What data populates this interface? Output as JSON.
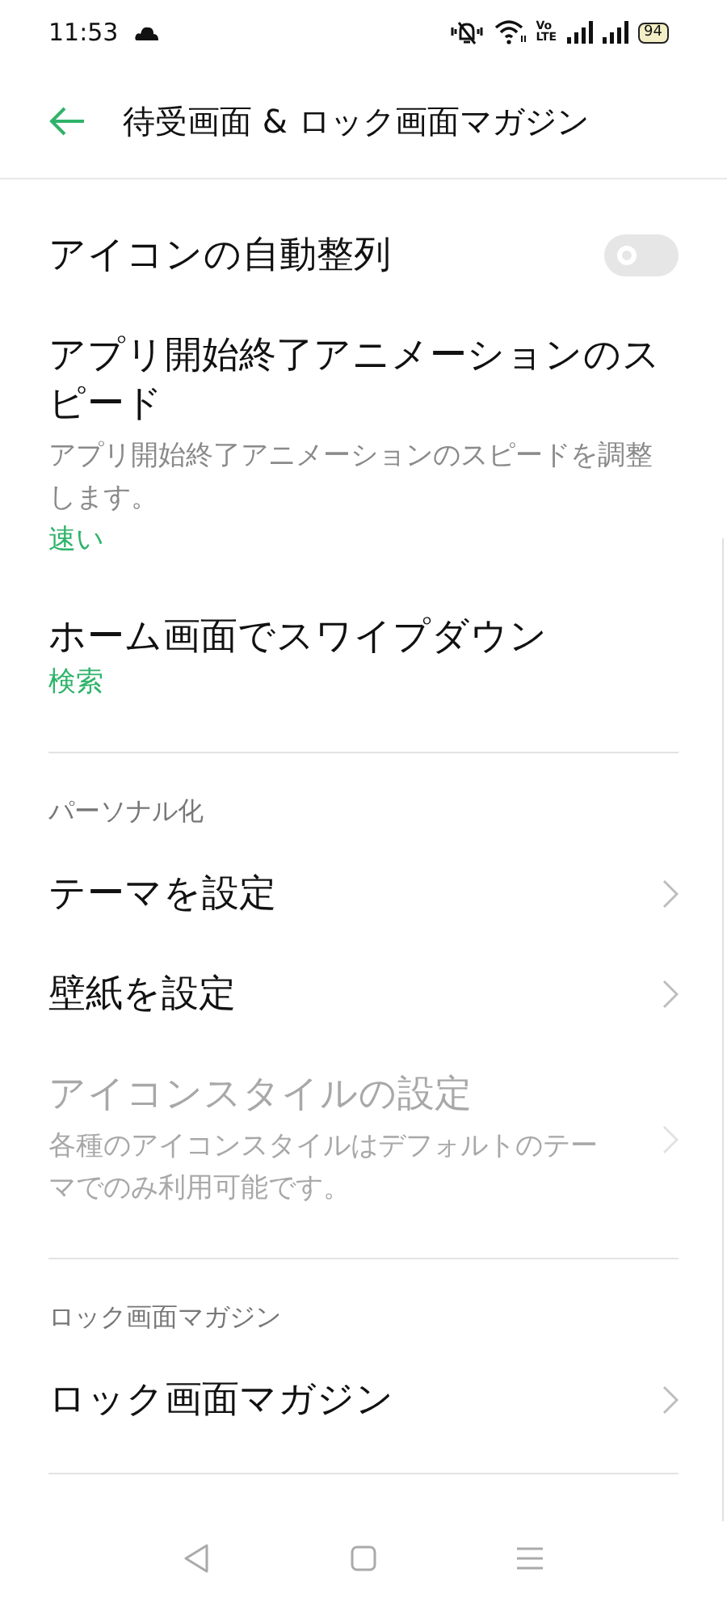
{
  "status_bar": {
    "time": "11:53",
    "volte_top": "Vo",
    "volte_bottom": "LTE",
    "battery": "94"
  },
  "app_bar": {
    "title": "待受画面 & ロック画面マガジン"
  },
  "sections": [
    {
      "items": [
        {
          "kind": "switch",
          "title": "アイコンの自動整列",
          "on": false
        },
        {
          "kind": "value",
          "title": "アプリ開始終了アニメーションのスピード",
          "description": "アプリ開始終了アニメーションのスピードを調整します。",
          "value": "速い"
        },
        {
          "kind": "value",
          "title": "ホーム画面でスワイプダウン",
          "value": "検索"
        }
      ]
    },
    {
      "header": "パーソナル化",
      "items": [
        {
          "kind": "link",
          "title": "テーマを設定",
          "disabled": false
        },
        {
          "kind": "link",
          "title": "壁紙を設定",
          "disabled": false
        },
        {
          "kind": "link",
          "title": "アイコンスタイルの設定",
          "description": "各種のアイコンスタイルはデフォルトのテーマでのみ利用可能です。",
          "disabled": true
        }
      ]
    },
    {
      "header": "ロック画面マガジン",
      "items": [
        {
          "kind": "link",
          "title": "ロック画面マガジン",
          "disabled": false
        }
      ]
    }
  ]
}
